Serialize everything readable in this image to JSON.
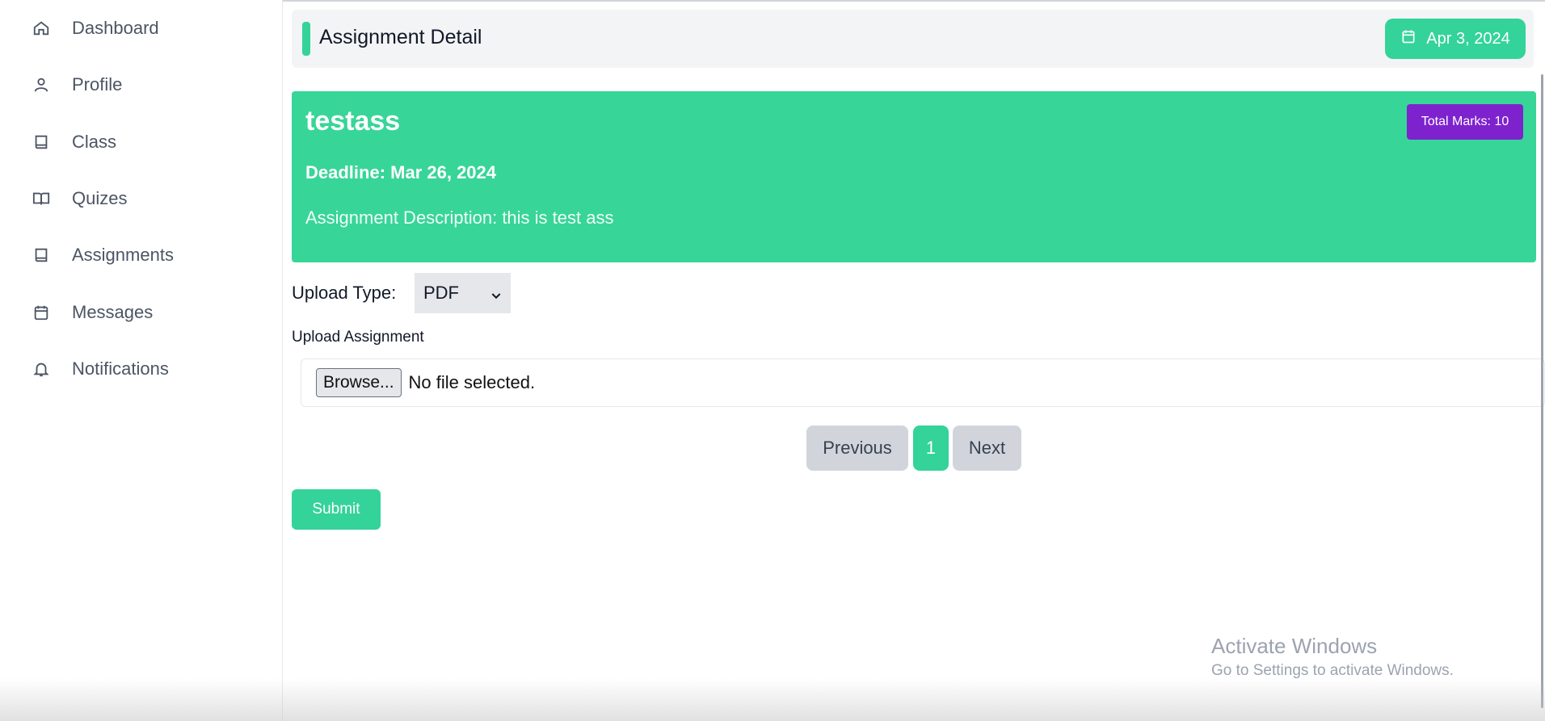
{
  "sidebar": {
    "items": [
      {
        "label": "Dashboard",
        "icon": "home-icon"
      },
      {
        "label": "Profile",
        "icon": "user-icon"
      },
      {
        "label": "Class",
        "icon": "book-icon"
      },
      {
        "label": "Quizes",
        "icon": "open-book-icon"
      },
      {
        "label": "Assignments",
        "icon": "book-icon"
      },
      {
        "label": "Messages",
        "icon": "calendar-icon"
      },
      {
        "label": "Notifications",
        "icon": "bell-icon"
      }
    ]
  },
  "header": {
    "title": "Assignment Detail",
    "date": "Apr 3, 2024"
  },
  "assignment": {
    "name": "testass",
    "total_marks": "Total Marks: 10",
    "deadline": "Deadline: Mar 26, 2024",
    "description": "Assignment Description: this is test ass"
  },
  "upload": {
    "type_label": "Upload Type:",
    "type_value": "PDF",
    "label": "Upload Assignment",
    "browse_label": "Browse...",
    "file_status": "No file selected."
  },
  "pagination": {
    "previous": "Previous",
    "current": "1",
    "next": "Next"
  },
  "submit_label": "Submit",
  "watermark": {
    "title": "Activate Windows",
    "subtitle": "Go to Settings to activate Windows."
  },
  "colors": {
    "accent": "#34d399",
    "badge": "#7e22ce"
  }
}
